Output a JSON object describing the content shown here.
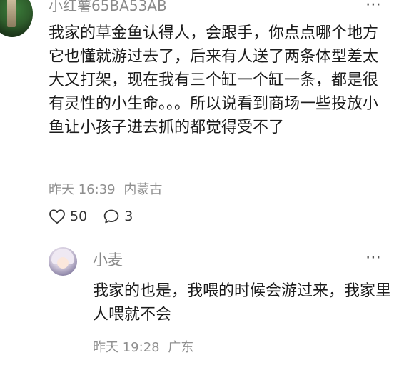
{
  "comment": {
    "username": "小红薯65BA53AB",
    "more_icon": "⋯",
    "body": "我家的草金鱼认得人，会跟手，你点点哪个地方它也懂就游过去了，后来有人送了两条体型差太大又打架，现在我有三个缸一个缸一条，都是很有灵性的小生命。。。所以说看到商场一些投放小鱼让小孩子进去抓的都觉得受不了",
    "time": "昨天 16:39",
    "location": "内蒙古",
    "like_count": "50",
    "reply_count": "3",
    "icons": {
      "like": "heart-outline-icon",
      "reply": "comment-bubble-icon",
      "more": "more-dots-icon"
    }
  },
  "reply": {
    "username": "小麦",
    "more_icon": "⋯",
    "body": "我家的也是，我喂的时候会游过来，我家里人喂就不会",
    "time": "昨天 19:28",
    "location": "广东"
  }
}
